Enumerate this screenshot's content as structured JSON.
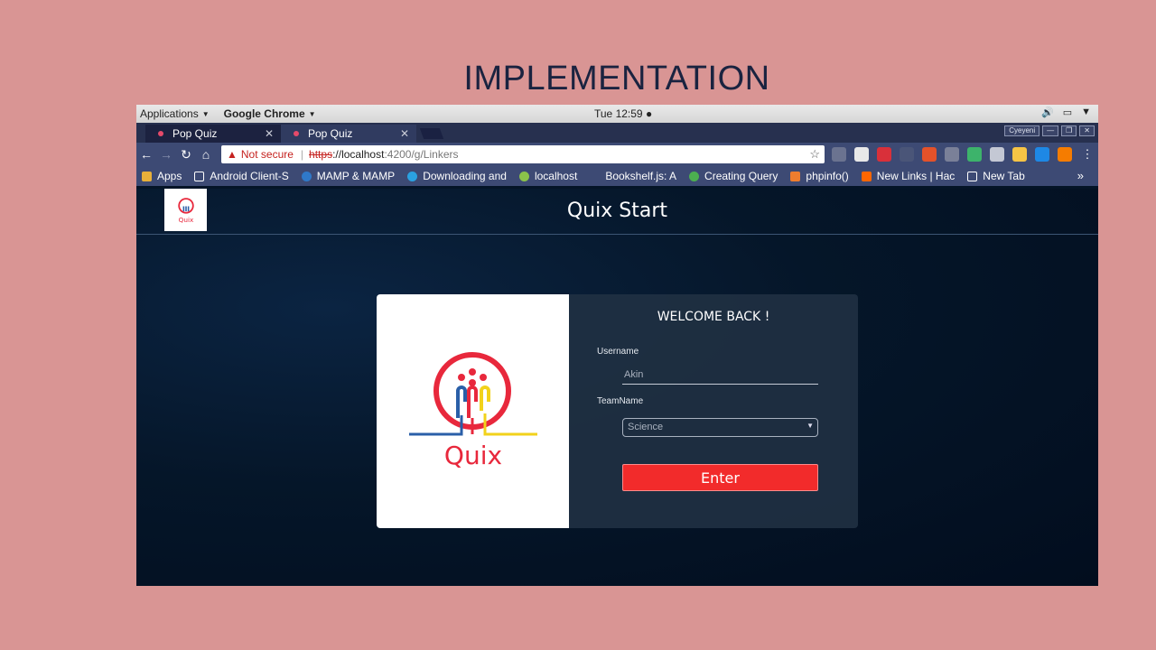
{
  "slide": {
    "title": "IMPLEMENTATION"
  },
  "gnome": {
    "applications": "Applications",
    "app_menu": "Google Chrome",
    "clock": "Tue 12:59",
    "keyboard_label": "Cyeyeni"
  },
  "chrome": {
    "tabs": [
      {
        "label": "Pop Quiz"
      },
      {
        "label": "Pop Quiz"
      }
    ],
    "omnibox": {
      "warning": "Not secure",
      "scheme": "https",
      "host": "://localhost",
      "path": ":4200/g/Linkers"
    },
    "bookmarks": [
      {
        "label": "Apps",
        "color": "#e8b03a"
      },
      {
        "label": "Android Client-S",
        "color": "#ffffff"
      },
      {
        "label": "MAMP & MAMP",
        "color": "#2f79c9"
      },
      {
        "label": "Downloading and",
        "color": "#2aa1e1"
      },
      {
        "label": "localhost",
        "color": "#8bc34a"
      },
      {
        "label": "Bookshelf.js: A",
        "color": "#3d4a74"
      },
      {
        "label": "Creating Query",
        "color": "#4caf50"
      },
      {
        "label": "phpinfo()",
        "color": "#ef7d2e"
      },
      {
        "label": "New Links | Hac",
        "color": "#ff6600"
      },
      {
        "label": "New Tab",
        "color": "#ffffff"
      }
    ],
    "more": "»"
  },
  "app": {
    "title": "Quix Start",
    "logo_text": "Quix",
    "welcome": "WELCOME BACK !",
    "username_label": "Username",
    "username_value": "Akin",
    "team_label": "TeamName",
    "team_value": "Science",
    "enter_label": "Enter"
  },
  "colors": {
    "slide_bg": "#d99594",
    "enter_button": "#f22b2b",
    "logo_red": "#e8283c",
    "logo_blue": "#2a5fa8",
    "logo_yellow": "#f2d21b"
  }
}
